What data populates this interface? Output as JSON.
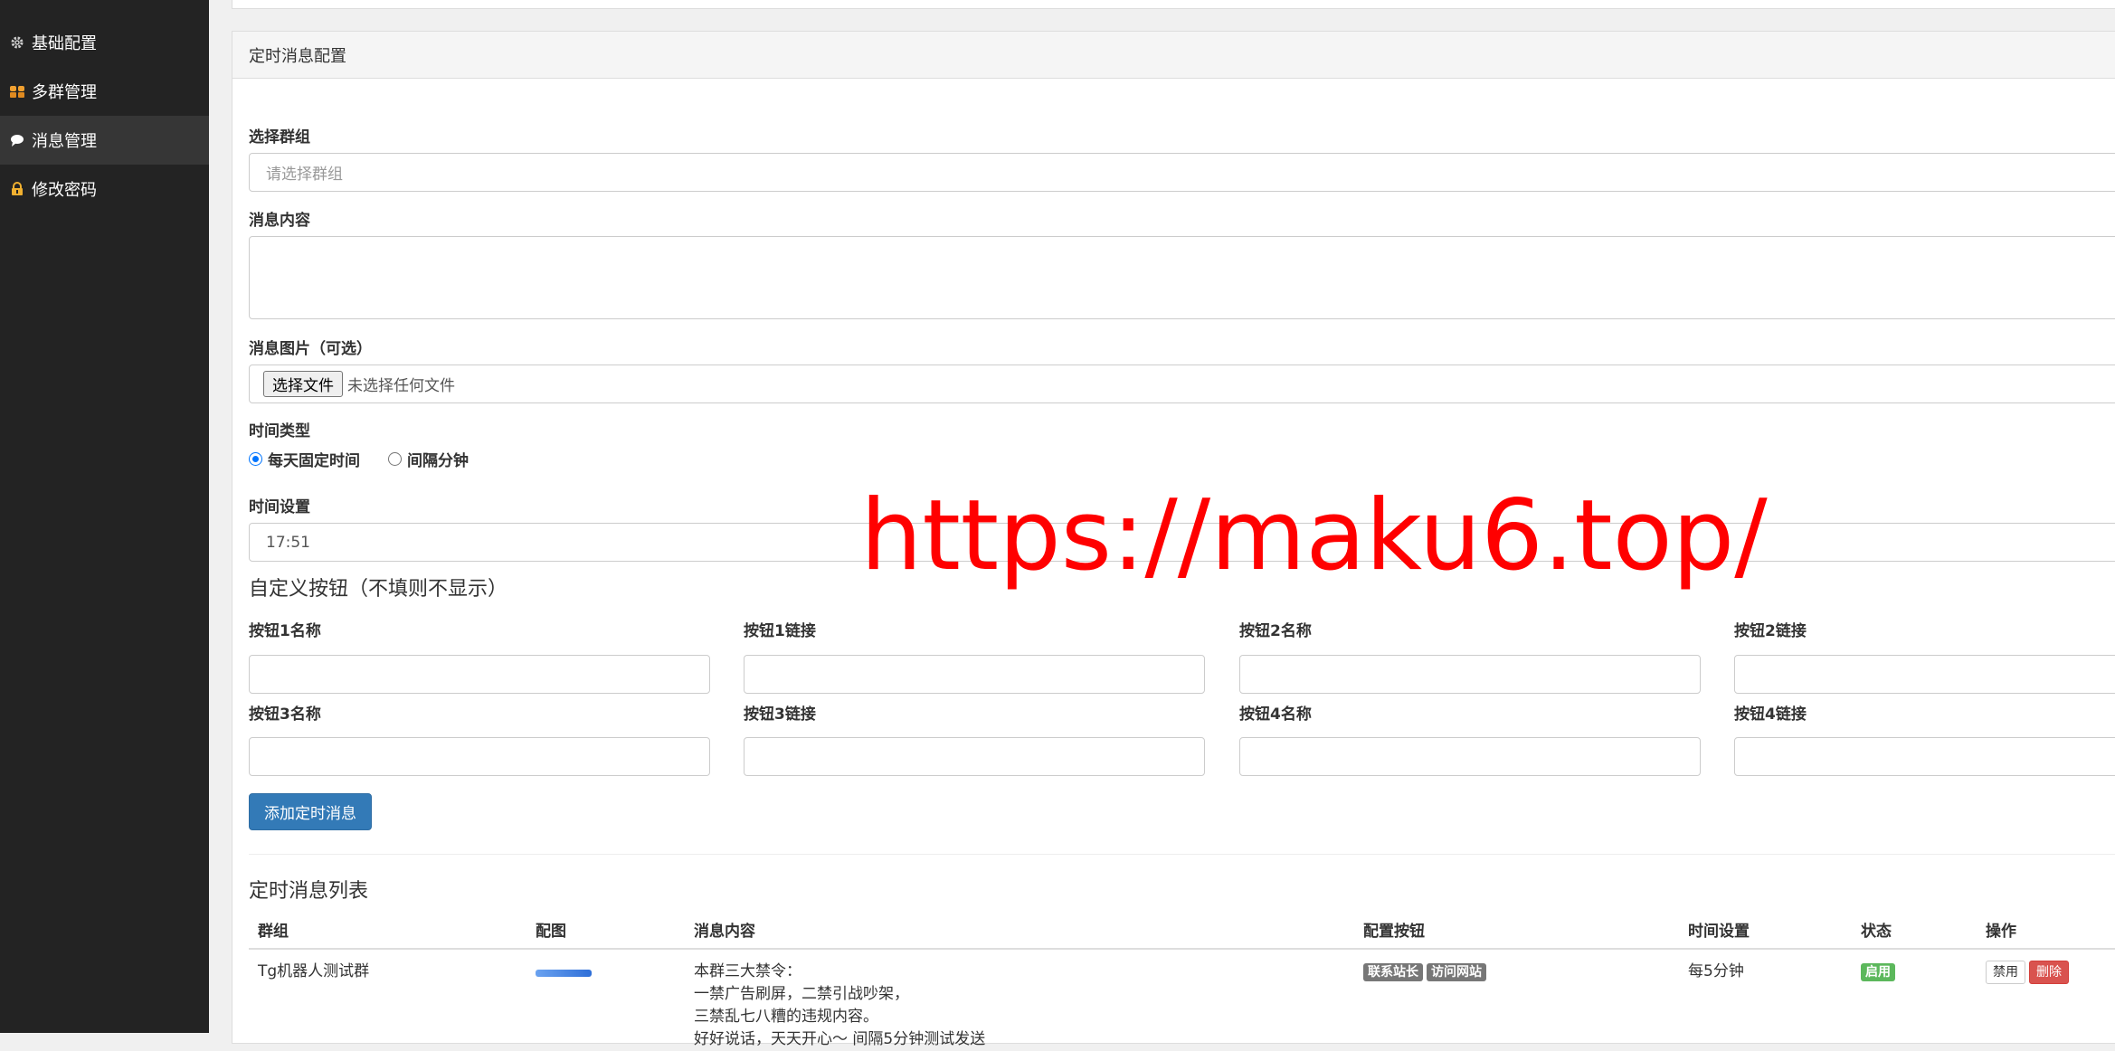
{
  "sidebar": {
    "items": [
      {
        "label": "基础配置",
        "icon": "gear-icon"
      },
      {
        "label": "多群管理",
        "icon": "users-icon"
      },
      {
        "label": "消息管理",
        "icon": "comment-icon"
      },
      {
        "label": "修改密码",
        "icon": "lock-icon"
      }
    ],
    "active_index": 2
  },
  "panel": {
    "heading": "定时消息配置"
  },
  "form": {
    "group_label": "选择群组",
    "group_placeholder": "请选择群组",
    "content_label": "消息内容",
    "image_label": "消息图片（可选）",
    "file_button": "选择文件",
    "file_status": "未选择任何文件",
    "time_type_label": "时间类型",
    "time_type_options": [
      {
        "label": "每天固定时间",
        "checked": true
      },
      {
        "label": "间隔分钟",
        "checked": false
      }
    ],
    "time_setting_label": "时间设置",
    "time_value": "17:51",
    "custom_buttons_title": "自定义按钮（不填则不显示）",
    "button_fields": [
      {
        "label": "按钮1名称"
      },
      {
        "label": "按钮1链接"
      },
      {
        "label": "按钮2名称"
      },
      {
        "label": "按钮2链接"
      },
      {
        "label": "按钮3名称"
      },
      {
        "label": "按钮3链接"
      },
      {
        "label": "按钮4名称"
      },
      {
        "label": "按钮4链接"
      }
    ],
    "submit_label": "添加定时消息"
  },
  "list": {
    "title": "定时消息列表",
    "columns": [
      "群组",
      "配图",
      "消息内容",
      "配置按钮",
      "时间设置",
      "状态",
      "操作"
    ],
    "rows": [
      {
        "group": "Tg机器人测试群",
        "content_lines": [
          "本群三大禁令：",
          "一禁广告刷屏，二禁引战吵架，",
          "三禁乱七八糟的违规内容。",
          "好好说话，天天开心～ 间隔5分钟测试发送"
        ],
        "buttons": [
          "联系站长",
          "访问网站"
        ],
        "time": "每5分钟",
        "status": "启用",
        "actions": {
          "disable": "禁用",
          "delete": "删除"
        }
      }
    ]
  },
  "watermark": "https://maku6.top/",
  "colors": {
    "sidebar_bg": "#232323",
    "sidebar_active": "#363636",
    "primary": "#337ab7",
    "success": "#5cb85c",
    "danger": "#d9534f",
    "watermark": "#ff0000"
  }
}
